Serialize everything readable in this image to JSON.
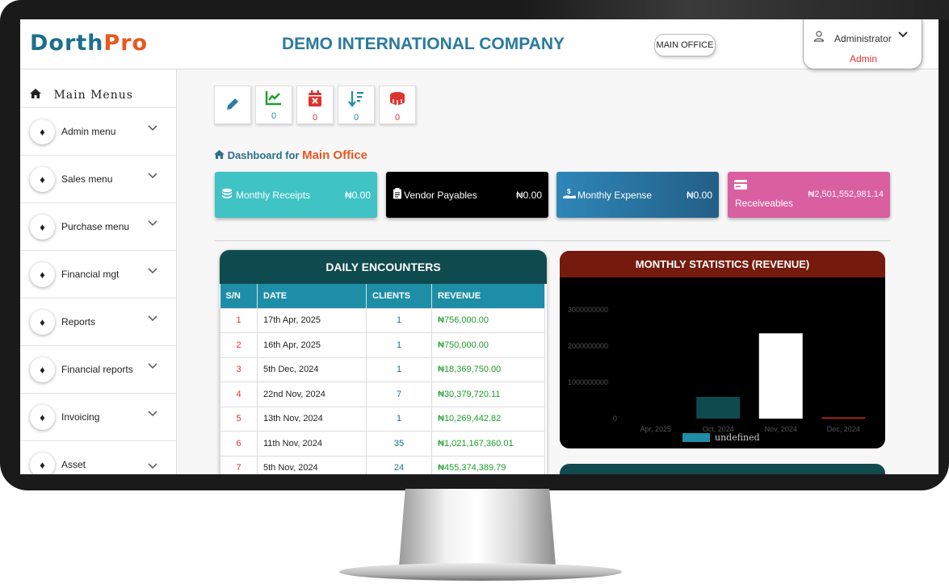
{
  "brand": {
    "logo_part1": "Dorth",
    "logo_part2": "Pro"
  },
  "header": {
    "company": "DEMO INTERNATIONAL COMPANY",
    "office_button": "MAIN OFFICE",
    "user_name": "Administrator",
    "user_role": "Admin"
  },
  "sidebar": {
    "title": "Main Menus",
    "items": [
      {
        "label": "Admin menu"
      },
      {
        "label": "Sales menu"
      },
      {
        "label": "Purchase menu"
      },
      {
        "label": "Financial mgt"
      },
      {
        "label": "Reports"
      },
      {
        "label": "Financial reports"
      },
      {
        "label": "Invoicing"
      },
      {
        "label": "Asset"
      }
    ]
  },
  "quick_tiles": [
    {
      "icon": "pencil-icon",
      "value": ""
    },
    {
      "icon": "chart-icon",
      "value": "0",
      "color": "#1b9e2a"
    },
    {
      "icon": "calendar-x-icon",
      "value": "0",
      "color": "#e0322d"
    },
    {
      "icon": "sort-icon",
      "value": "0",
      "color": "#1d8ea6"
    },
    {
      "icon": "drum-icon",
      "value": "0",
      "color": "#e0322d"
    }
  ],
  "dashboard": {
    "prefix": "Dashboard for",
    "office": "Main Office"
  },
  "cards": [
    {
      "label": "Monthly Receipts",
      "value": "₦0.00",
      "color": "#3fc3c5"
    },
    {
      "label": "Vendor Payables",
      "value": "₦0.00",
      "color": "#000000"
    },
    {
      "label": "Monthly Expense",
      "value": "₦0.00",
      "color": "#2a6fa0"
    },
    {
      "label": "Receiveables",
      "value": "₦2,501,552,981.14",
      "color": "#d95fa1"
    }
  ],
  "encounters": {
    "title": "DAILY ENCOUNTERS",
    "columns": [
      "S/N",
      "DATE",
      "CLIENTS",
      "REVENUE"
    ],
    "rows": [
      [
        "1",
        "17th Apr, 2025",
        "1",
        "₦756,000.00"
      ],
      [
        "2",
        "16th Apr, 2025",
        "1",
        "₦750,000.00"
      ],
      [
        "3",
        "5th Dec, 2024",
        "1",
        "₦18,369,750.00"
      ],
      [
        "4",
        "22nd Nov, 2024",
        "7",
        "₦30,379,720.11"
      ],
      [
        "5",
        "13th Nov, 2024",
        "1",
        "₦10,269,442.82"
      ],
      [
        "6",
        "11th Nov, 2024",
        "35",
        "₦1,021,167,360.01"
      ],
      [
        "7",
        "5th Nov, 2024",
        "24",
        "₦455,374,389.79"
      ]
    ]
  },
  "chart_data": {
    "type": "bar",
    "title": "MONTHLY STATISTICS (REVENUE)",
    "categories": [
      "Apr, 2025",
      "Oct, 2024",
      "Nov, 2024",
      "Dec, 2024"
    ],
    "series": [
      {
        "name": "undefined",
        "values": [
          0,
          600000000,
          2350000000,
          18369750
        ]
      }
    ],
    "colors": [
      "#0f4a4f",
      "#0f4a4f",
      "#ffffff",
      "#d42a1d"
    ],
    "legend_color": "#1d8ea6",
    "y_ticks": [
      "0",
      "1000000000",
      "2000000000",
      "3000000000"
    ],
    "ylim": [
      0,
      3000000000
    ],
    "legend": "bottom"
  }
}
